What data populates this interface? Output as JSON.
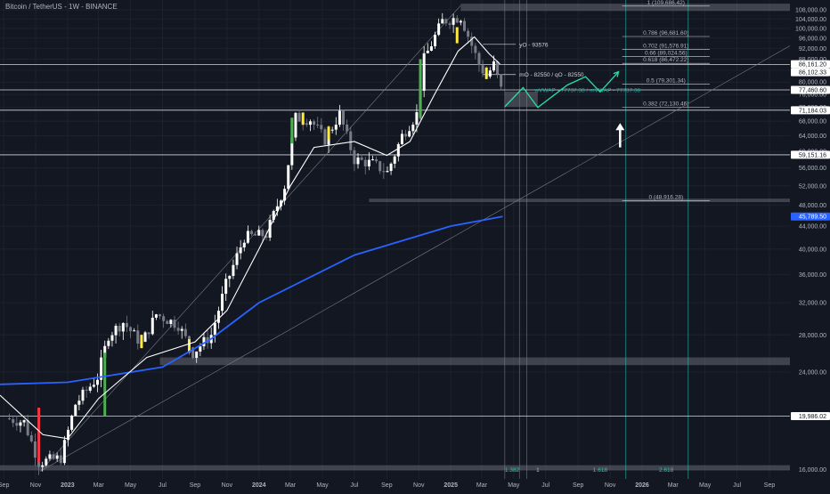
{
  "header": {
    "title": "Bitcoin / TetherUS - 1W - BINANCE"
  },
  "colors": {
    "background": "#131722",
    "grid": "#1e222d",
    "axis_text": "#b2b5be",
    "candle_up": "#ffffff",
    "candle_down": "#787b86",
    "accent_green": "#4caf50",
    "accent_red": "#f23645",
    "accent_yellow": "#ffeb3b",
    "ma_blue": "#2962ff",
    "projection": "#26e0a5",
    "fib_teal": "#2ec4b6",
    "ma_white": "#ffffff",
    "badge_blue": "#2962ff"
  },
  "chart_data": {
    "type": "candlestick",
    "title": "Bitcoin / TetherUS - 1W - BINANCE",
    "y_scale": "log",
    "ylim": [
      15400,
      112500
    ],
    "xlim": [
      "2022-08-25",
      "2026-10-10"
    ],
    "grid": true,
    "y_ticks": [
      "108,000.00",
      "104,000.00",
      "100,000.00",
      "96,000.00",
      "92,000.00",
      "88,000.00",
      "84,000.00",
      "80,000.00",
      "76,000.00",
      "72,000.00",
      "68,000.00",
      "64,000.00",
      "60,000.00",
      "56,000.00",
      "52,000.00",
      "48,000.00",
      "44,000.00",
      "40,000.00",
      "36,000.00",
      "32,000.00",
      "28,000.00",
      "24,000.00",
      "20,000.00",
      "16,000.00"
    ],
    "x_ticks": [
      {
        "label": "Sep",
        "date": "2022-09-01"
      },
      {
        "label": "Nov",
        "date": "2022-11-01"
      },
      {
        "label": "2023",
        "date": "2023-01-01"
      },
      {
        "label": "Mar",
        "date": "2023-03-01"
      },
      {
        "label": "May",
        "date": "2023-05-01"
      },
      {
        "label": "Jul",
        "date": "2023-07-01"
      },
      {
        "label": "Sep",
        "date": "2023-09-01"
      },
      {
        "label": "Nov",
        "date": "2023-11-01"
      },
      {
        "label": "2024",
        "date": "2024-01-01"
      },
      {
        "label": "Mar",
        "date": "2024-03-01"
      },
      {
        "label": "May",
        "date": "2024-05-01"
      },
      {
        "label": "Jul",
        "date": "2024-07-01"
      },
      {
        "label": "Sep",
        "date": "2024-09-01"
      },
      {
        "label": "Nov",
        "date": "2024-11-01"
      },
      {
        "label": "2025",
        "date": "2025-01-01"
      },
      {
        "label": "Mar",
        "date": "2025-03-01"
      },
      {
        "label": "May",
        "date": "2025-05-01"
      },
      {
        "label": "Jul",
        "date": "2025-07-01"
      },
      {
        "label": "Sep",
        "date": "2025-09-01"
      },
      {
        "label": "Nov",
        "date": "2025-11-01"
      },
      {
        "label": "2026",
        "date": "2026-01-01"
      },
      {
        "label": "Mar",
        "date": "2026-03-01"
      },
      {
        "label": "May",
        "date": "2026-05-01"
      },
      {
        "label": "Jul",
        "date": "2026-07-01"
      },
      {
        "label": "Sep",
        "date": "2026-09-01"
      }
    ],
    "close_path": [
      [
        "2022-09-05",
        19800
      ],
      [
        "2022-10-10",
        19500
      ],
      [
        "2022-11-07",
        16500
      ],
      [
        "2022-12-19",
        16800
      ],
      [
        "2023-01-16",
        21000
      ],
      [
        "2023-02-27",
        23500
      ],
      [
        "2023-03-20",
        28000
      ],
      [
        "2023-04-17",
        29500
      ],
      [
        "2023-05-22",
        27000
      ],
      [
        "2023-06-19",
        30500
      ],
      [
        "2023-07-31",
        29200
      ],
      [
        "2023-08-28",
        26000
      ],
      [
        "2023-10-02",
        28000
      ],
      [
        "2023-10-30",
        34500
      ],
      [
        "2023-12-04",
        42000
      ],
      [
        "2024-01-15",
        42500
      ],
      [
        "2024-02-19",
        52000
      ],
      [
        "2024-03-11",
        69000
      ],
      [
        "2024-04-08",
        68500
      ],
      [
        "2024-05-06",
        63000
      ],
      [
        "2024-06-03",
        70000
      ],
      [
        "2024-07-01",
        58000
      ],
      [
        "2024-08-05",
        57000
      ],
      [
        "2024-09-02",
        55000
      ],
      [
        "2024-09-30",
        64000
      ],
      [
        "2024-10-28",
        70000
      ],
      [
        "2024-11-11",
        88000
      ],
      [
        "2024-12-16",
        103000
      ],
      [
        "2025-01-20",
        105000
      ],
      [
        "2025-02-03",
        97000
      ],
      [
        "2025-02-24",
        86000
      ],
      [
        "2025-03-10",
        82000
      ],
      [
        "2025-03-24",
        86000
      ],
      [
        "2025-04-07",
        77500
      ]
    ],
    "green_candles": [
      [
        "2023-03-13",
        20000,
        26000
      ],
      [
        "2024-03-04",
        62000,
        69000
      ],
      [
        "2024-11-04",
        69000,
        88000
      ]
    ],
    "red_candles": [
      [
        "2022-11-07",
        20700,
        16500
      ]
    ],
    "yellow_candles": [
      [
        "2023-05-22",
        26500,
        28000
      ],
      [
        "2023-08-21",
        26000,
        27500
      ],
      [
        "2024-03-25",
        67000,
        70500
      ],
      [
        "2024-05-13",
        63000,
        66500
      ],
      [
        "2025-01-13",
        94000,
        100500
      ],
      [
        "2025-03-10",
        81000,
        85000
      ]
    ],
    "series": [
      {
        "name": "",
        "values": [
          [
            "2022-08-25",
            22800
          ],
          [
            "2023-01-01",
            23000
          ],
          [
            "2023-07-01",
            24500
          ],
          [
            "2023-10-01",
            27500
          ],
          [
            "2024-01-01",
            32000
          ],
          [
            "2024-07-01",
            39000
          ],
          [
            "2025-01-01",
            44000
          ],
          [
            "2025-04-10",
            45790
          ]
        ]
      },
      {
        "name": "",
        "values": [
          [
            "2022-08-25",
            21800
          ],
          [
            "2022-11-15",
            18500
          ],
          [
            "2023-01-01",
            18200
          ],
          [
            "2023-03-01",
            21500
          ],
          [
            "2023-06-01",
            25500
          ],
          [
            "2023-09-01",
            27200
          ],
          [
            "2023-11-01",
            31000
          ],
          [
            "2024-01-01",
            40000
          ],
          [
            "2024-03-01",
            52000
          ],
          [
            "2024-04-15",
            61000
          ],
          [
            "2024-07-01",
            62500
          ],
          [
            "2024-09-01",
            59000
          ],
          [
            "2024-10-15",
            62500
          ],
          [
            "2024-12-01",
            76000
          ],
          [
            "2025-01-15",
            91000
          ],
          [
            "2025-02-15",
            96500
          ],
          [
            "2025-03-15",
            90000
          ],
          [
            "2025-04-05",
            86200
          ]
        ]
      }
    ],
    "trendlines": [
      {
        "from": [
          "2022-11-10",
          15900
        ],
        "to": [
          "2025-01-20",
          110000
        ]
      },
      {
        "from": [
          "2022-11-10",
          15900
        ],
        "to": [
          "2026-10-10",
          93000
        ]
      }
    ],
    "projection_path": [
      [
        "2025-04-14",
        72200
      ],
      [
        "2025-05-19",
        78200
      ],
      [
        "2025-06-16",
        72000
      ],
      [
        "2025-08-11",
        79000
      ],
      [
        "2025-09-15",
        81800
      ],
      [
        "2025-10-13",
        76800
      ],
      [
        "2025-11-17",
        83500
      ]
    ],
    "arrow": {
      "from": [
        "2025-11-20",
        61000
      ],
      "to": [
        "2025-11-20",
        67000
      ]
    },
    "horizontal_levels": [
      {
        "value": 86102.33,
        "label": "86,102.33"
      },
      {
        "value": 77460.6,
        "label": "77,460.60"
      },
      {
        "value": 71184.03,
        "label": "71,184.03"
      },
      {
        "value": 59151.16,
        "label": "59,151.16"
      },
      {
        "value": 19986.02,
        "label": "19,986.02"
      }
    ],
    "price_labels": [
      {
        "value": 86161.2,
        "label": "86,161.20",
        "style": "white"
      },
      {
        "value": 86102.33,
        "label": "86,102.33",
        "style": "white"
      },
      {
        "value": 77460.6,
        "label": "77,460.60",
        "style": "white"
      },
      {
        "value": 71184.03,
        "label": "71,184.03",
        "style": "white"
      },
      {
        "value": 59151.16,
        "label": "59,151.16",
        "style": "white"
      },
      {
        "value": 45789.5,
        "label": "45,789.50",
        "style": "blue"
      },
      {
        "value": 19986.02,
        "label": "19,986.02",
        "style": "white"
      }
    ],
    "fib_levels": [
      {
        "ratio": "1",
        "value": 109686.42,
        "label": "1 (109,686.42)"
      },
      {
        "ratio": "0.786",
        "value": 96681.6,
        "label": "0.786 (96,681.60)"
      },
      {
        "ratio": "0.702",
        "value": 91576.91,
        "label": "0.702 (91,576.91)"
      },
      {
        "ratio": "0.66",
        "value": 89024.56,
        "label": "0.66 (89,024.56)"
      },
      {
        "ratio": "0.618",
        "value": 86472.22,
        "label": "0.618 (86,472.22)"
      },
      {
        "ratio": "0.5",
        "value": 79301.34,
        "label": "0.5 (79,301.34)"
      },
      {
        "ratio": "0.382",
        "value": 72130.46,
        "label": "0.382 (72,130.46)"
      },
      {
        "ratio": "0",
        "value": 48916.28,
        "label": "0 (48,916.28)"
      }
    ],
    "open_levels": [
      {
        "value": 93576,
        "label": "yO - 93576"
      },
      {
        "value": 82550,
        "label": "mO - 82550 / qO - 82550"
      }
    ],
    "vwap_label": {
      "value": 77450,
      "label": "wVWAP - 77737.38 / mVWAP - 77737.38"
    },
    "zones": [
      {
        "from": "2025-01-20",
        "to": "2026-10-10",
        "low": 107500,
        "high": 110800
      },
      {
        "from": "2024-07-29",
        "to": "2026-10-10",
        "low": 48600,
        "high": 49300
      },
      {
        "from": "2023-06-26",
        "to": "2026-10-10",
        "low": 24700,
        "high": 25500
      },
      {
        "from": "2022-08-25",
        "to": "2026-10-10",
        "low": 15950,
        "high": 16300
      },
      {
        "from": "2025-04-14",
        "to": "2025-06-16",
        "low": 72200,
        "high": 76900
      }
    ],
    "vlines": [
      "2025-04-14",
      "2025-05-12",
      "2025-05-26",
      "2025-12-01",
      "2026-03-30"
    ],
    "bottom_markers": [
      {
        "date": "2025-04-28",
        "label": "1.382"
      },
      {
        "date": "2025-06-16",
        "label": "1"
      },
      {
        "date": "2025-10-13",
        "label": "1.618"
      },
      {
        "date": "2026-02-16",
        "label": "2.618"
      }
    ]
  }
}
